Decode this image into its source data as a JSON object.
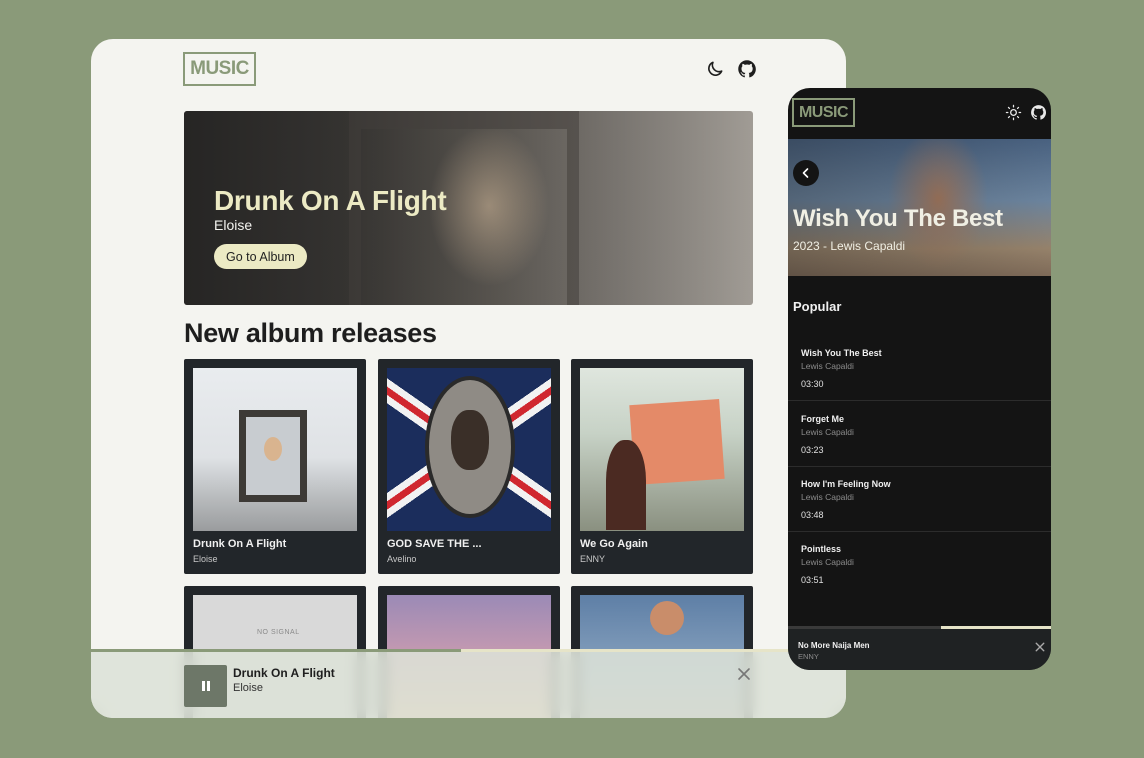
{
  "desktop": {
    "logo": "MUSIC",
    "hero": {
      "title": "Drunk On A Flight",
      "artist": "Eloise",
      "button": "Go to Album"
    },
    "section_title": "New album releases",
    "albums": [
      {
        "title": "Drunk On A Flight",
        "artist": "Eloise"
      },
      {
        "title": "GOD SAVE THE ...",
        "artist": "Avelino"
      },
      {
        "title": "We Go Again",
        "artist": "ENNY"
      }
    ],
    "album_cover_text": "NO SIGNAL",
    "player": {
      "title": "Drunk On A Flight",
      "artist": "Eloise",
      "progress": 0.49
    },
    "icons": {
      "theme": "moon-icon",
      "github": "github-icon",
      "pause": "pause-icon",
      "close": "close-icon"
    }
  },
  "mobile": {
    "logo": "MUSIC",
    "album": {
      "title": "Wish You The Best",
      "subtitle": "2023 - Lewis Capaldi"
    },
    "section": "Popular",
    "tracks": [
      {
        "title": "Wish You The Best",
        "artist": "Lewis Capaldi",
        "duration": "03:30"
      },
      {
        "title": "Forget Me",
        "artist": "Lewis Capaldi",
        "duration": "03:23"
      },
      {
        "title": "How I'm Feeling Now",
        "artist": "Lewis Capaldi",
        "duration": "03:48"
      },
      {
        "title": "Pointless",
        "artist": "Lewis Capaldi",
        "duration": "03:51"
      }
    ],
    "player": {
      "title": "No More Naija Men",
      "artist": "ENNY",
      "progress": 0.58
    },
    "icons": {
      "theme": "sun-icon",
      "github": "github-icon",
      "back": "chevron-left-icon",
      "close": "close-icon"
    }
  },
  "colors": {
    "background": "#8a9a79",
    "accent": "#8a9a79",
    "highlight": "#eceac4",
    "card": "#22262a",
    "mobile_bg": "#141414"
  }
}
